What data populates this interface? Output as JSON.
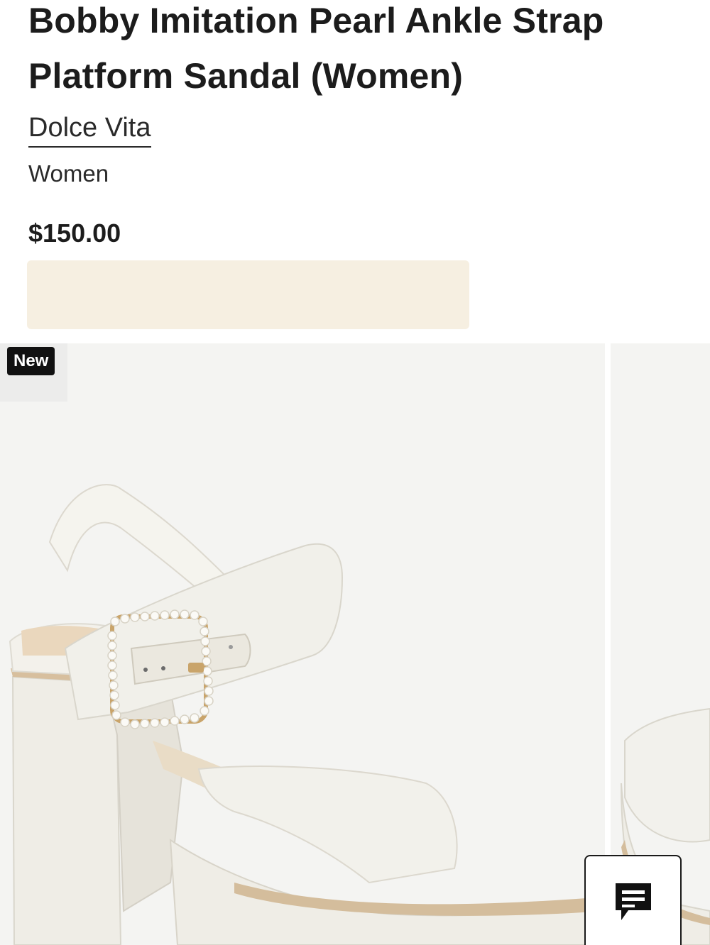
{
  "product": {
    "title": "Bobby Imitation Pearl Ankle Strap Platform Sandal (Women)",
    "brand": "Dolce Vita",
    "category": "Women",
    "price": "$150.00"
  },
  "gallery": {
    "badge": "New",
    "image_alt": "White satin platform sandal with imitation pearl buckle ankle strap"
  },
  "chat": {
    "icon": "chat-icon",
    "label": "Chat"
  },
  "colors": {
    "promo_bg": "#f6efe1",
    "image_bg": "#f4f4f2",
    "badge_bg": "#111111",
    "text": "#1c1c1c"
  }
}
